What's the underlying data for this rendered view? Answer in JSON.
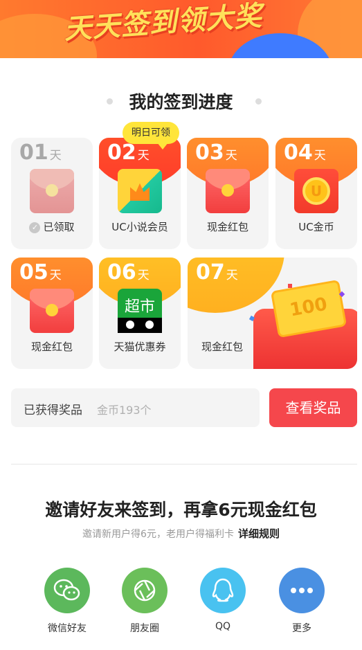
{
  "banner": {
    "title": "天天签到领大奖"
  },
  "progress": {
    "title": "我的签到进度",
    "tooltip": "明日可领",
    "unit": "天",
    "days": [
      {
        "day": "01",
        "label": "已领取",
        "claimed": true
      },
      {
        "day": "02",
        "label": "UC小说会员"
      },
      {
        "day": "03",
        "label": "现金红包"
      },
      {
        "day": "04",
        "label": "UC金币"
      },
      {
        "day": "05",
        "label": "现金红包"
      },
      {
        "day": "06",
        "label": "天猫优惠券",
        "icon_text": "超市"
      },
      {
        "day": "07",
        "label": "现金红包",
        "card_value": "100"
      }
    ]
  },
  "prizes": {
    "label": "已获得奖品",
    "value": "金币193个",
    "button": "查看奖品"
  },
  "invite": {
    "title": "邀请好友来签到，再拿6元现金红包",
    "subtitle": "邀请新用户得6元，老用户得福利卡",
    "rule_link": "详细规则"
  },
  "share": [
    {
      "name": "微信好友",
      "color": "#5cb85c"
    },
    {
      "name": "朋友圈",
      "color": "#6bbf5a"
    },
    {
      "name": "QQ",
      "color": "#49c2f0"
    },
    {
      "name": "更多",
      "color": "#4a90e2"
    }
  ]
}
